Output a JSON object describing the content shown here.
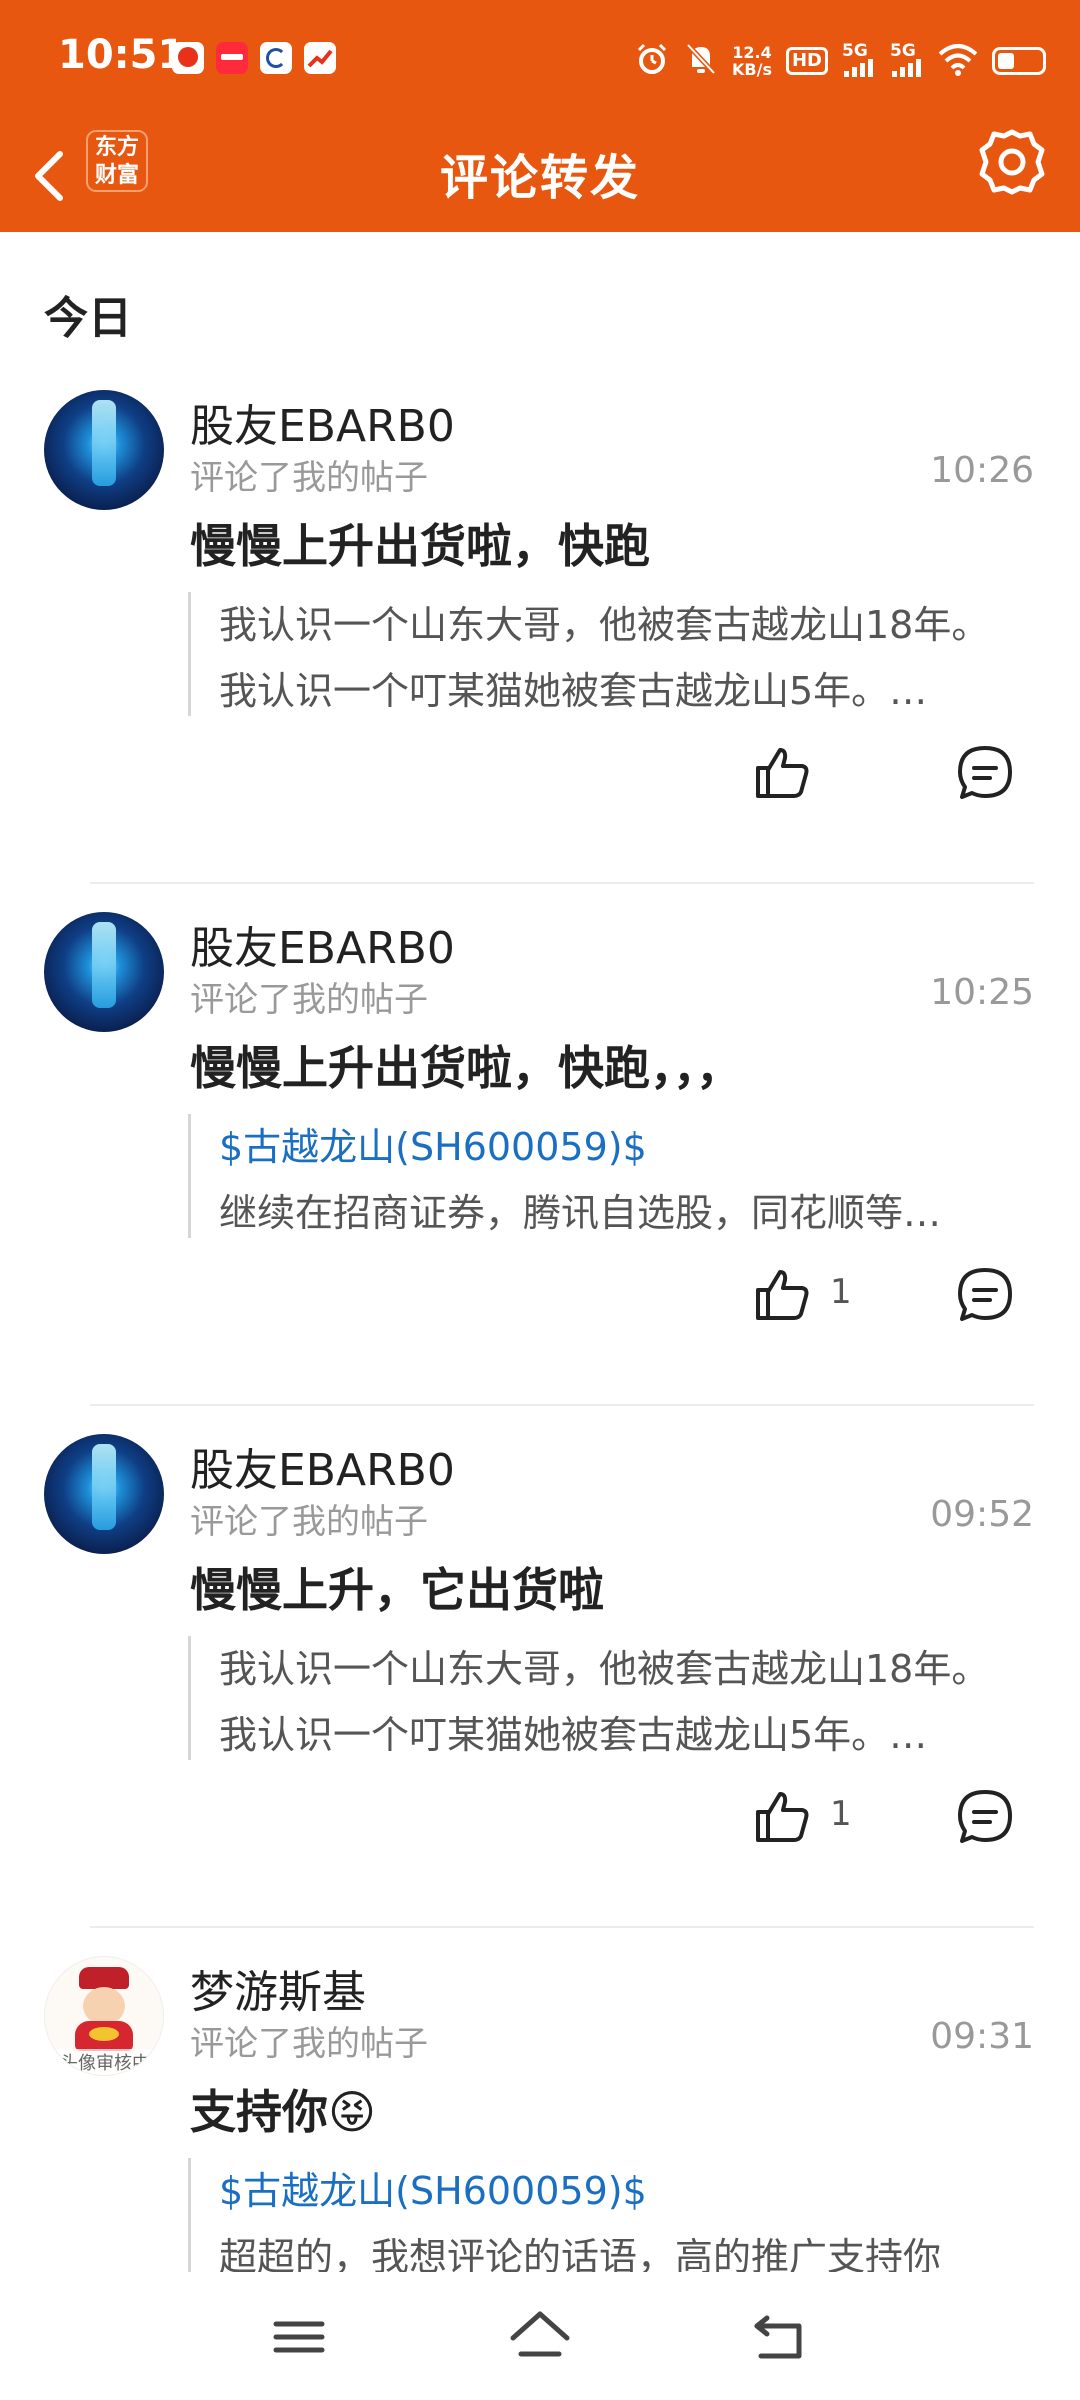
{
  "status_bar": {
    "time": "10:51",
    "net_speed_value": "12.4",
    "net_speed_unit": "KB/s",
    "hd_label": "HD",
    "sig1": "5G",
    "sig2": "5G",
    "notif_icons": [
      "app-heart-icon",
      "app-xiaohongshu-icon",
      "app-c-icon",
      "app-stock-icon"
    ],
    "icons": [
      "alarm-icon",
      "mute-bell-icon",
      "hd-icon",
      "signal-icon",
      "signal-icon",
      "wifi-icon",
      "battery-icon"
    ]
  },
  "header": {
    "title": "评论转发",
    "brand_line1": "东方",
    "brand_line2": "财富"
  },
  "section": {
    "title": "今日"
  },
  "items": [
    {
      "user": "股友EBARB0",
      "action": "评论了我的帖子",
      "time": "10:26",
      "comment": "慢慢上升出货啦，快跑",
      "quote_link": "",
      "quote_lines": [
        "我认识一个山东大哥，他被套古越龙山18年。",
        "我认识一个叮某猫她被套古越龙山5年。…"
      ],
      "likes": ""
    },
    {
      "user": "股友EBARB0",
      "action": "评论了我的帖子",
      "time": "10:25",
      "comment": "慢慢上升出货啦，快跑，，，",
      "quote_link": "$古越龙山(SH600059)$",
      "quote_lines": [
        "继续在招商证券，腾讯自选股，同花顺等…"
      ],
      "likes": "1"
    },
    {
      "user": "股友EBARB0",
      "action": "评论了我的帖子",
      "time": "09:52",
      "comment": "慢慢上升，它出货啦",
      "quote_link": "",
      "quote_lines": [
        "我认识一个山东大哥，他被套古越龙山18年。",
        "我认识一个叮某猫她被套古越龙山5年。…"
      ],
      "likes": "1"
    },
    {
      "user": "梦游斯基",
      "action": "评论了我的帖子",
      "time": "09:31",
      "comment": "支持你😝",
      "quote_link": "$古越龙山(SH600059)$",
      "quote_lines": [
        "超超的，我想评论的话语，高的推广支持你"
      ],
      "likes": "",
      "avatar_overlay": "头像审核中"
    }
  ],
  "nav": {
    "icons": [
      "menu-icon",
      "home-icon",
      "back-icon"
    ]
  },
  "colors": {
    "brand": "#e8570f",
    "link": "#1a6fc2",
    "muted": "#999999"
  }
}
